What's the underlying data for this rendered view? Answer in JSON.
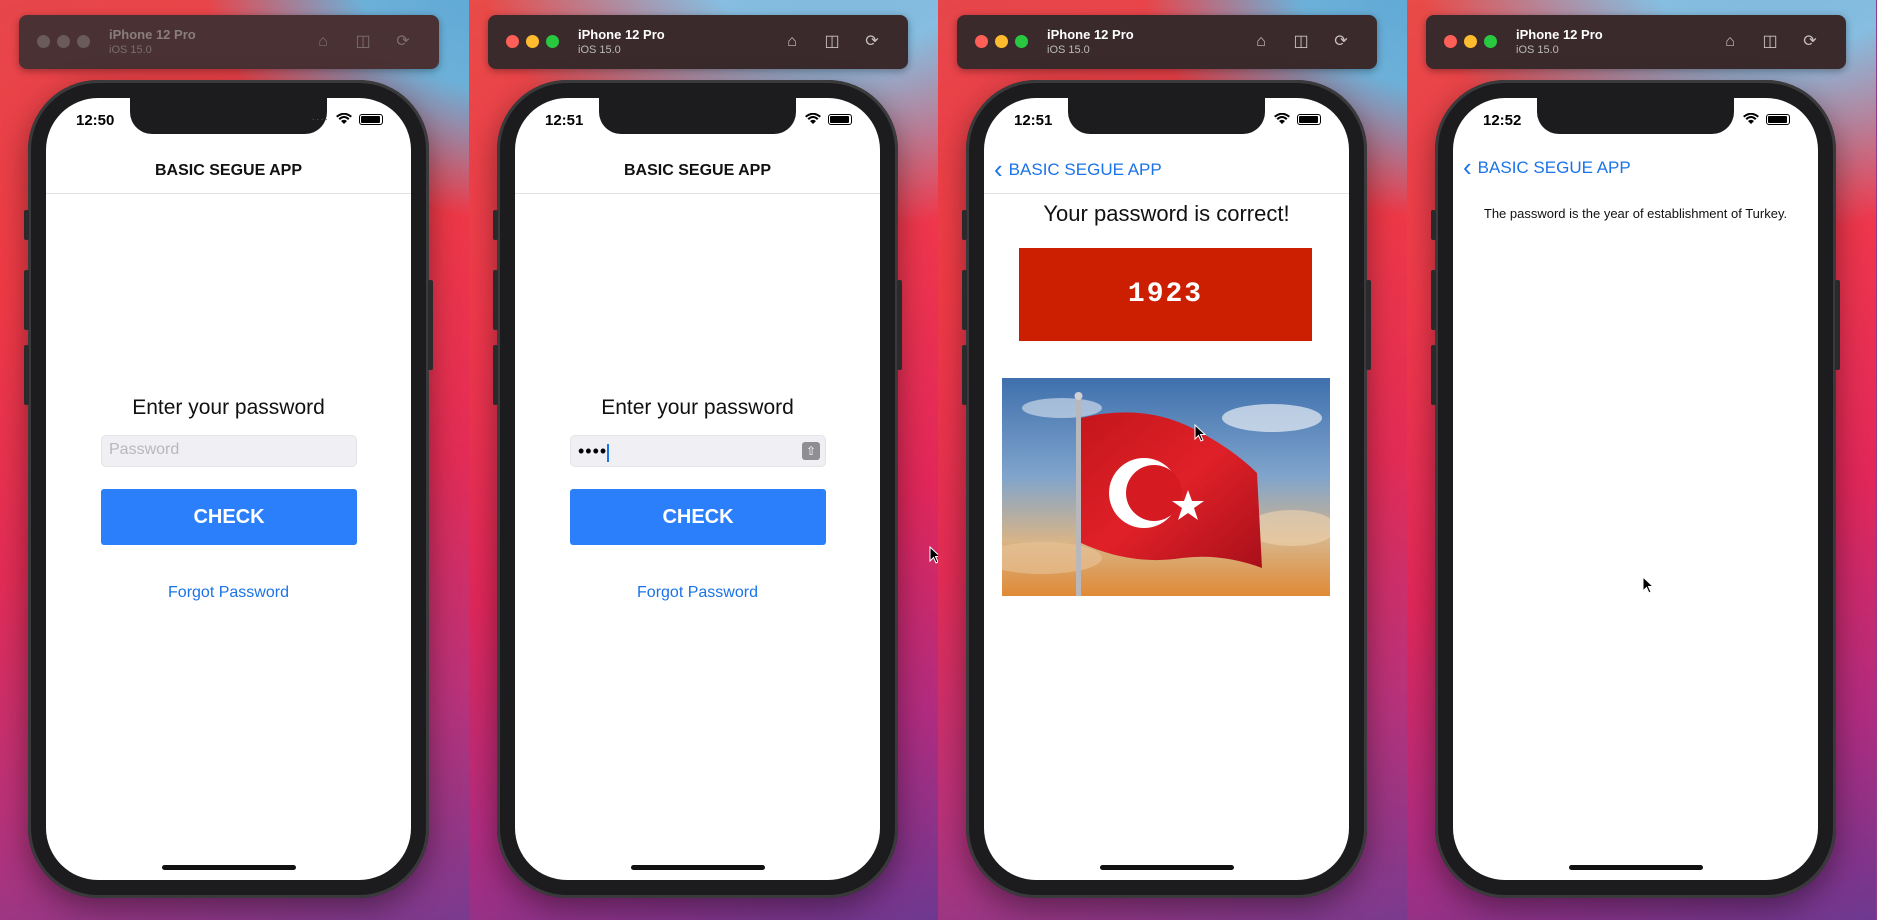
{
  "device": {
    "name": "iPhone 12 Pro",
    "os": "iOS 15.0"
  },
  "panels": [
    {
      "time": "12:50",
      "nav_title": "BASIC SEGUE APP",
      "prompt": "Enter your password",
      "placeholder": "Password",
      "check_label": "CHECK",
      "forgot_label": "Forgot Password"
    },
    {
      "time": "12:51",
      "nav_title": "BASIC SEGUE APP",
      "prompt": "Enter your password",
      "password_dots": "••••",
      "check_label": "CHECK",
      "forgot_label": "Forgot Password"
    },
    {
      "time": "12:51",
      "back_label": "BASIC SEGUE APP",
      "message": "Your password is correct!",
      "year": "1923",
      "image": "turkish-flag"
    },
    {
      "time": "12:52",
      "back_label": "BASIC SEGUE APP",
      "hint": "The password is the year of establishment of Turkey."
    }
  ],
  "colors": {
    "accent": "#2c7ffb",
    "link": "#1a73e8",
    "year_box": "#cc1e00"
  }
}
